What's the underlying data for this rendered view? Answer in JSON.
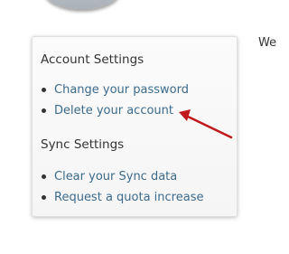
{
  "colors": {
    "link": "#3c6a8b",
    "text": "#333333",
    "annotation_arrow": "#c0191b"
  },
  "page": {
    "side_text": "We"
  },
  "settings_panel": {
    "account_title": "Account Settings",
    "account_links": [
      {
        "label": "Change your password"
      },
      {
        "label": "Delete your account"
      }
    ],
    "sync_title": "Sync Settings",
    "sync_links": [
      {
        "label": "Clear your Sync data"
      },
      {
        "label": "Request a quota increase"
      }
    ]
  },
  "annotation": {
    "icon": "arrow-pointing-left-icon"
  }
}
